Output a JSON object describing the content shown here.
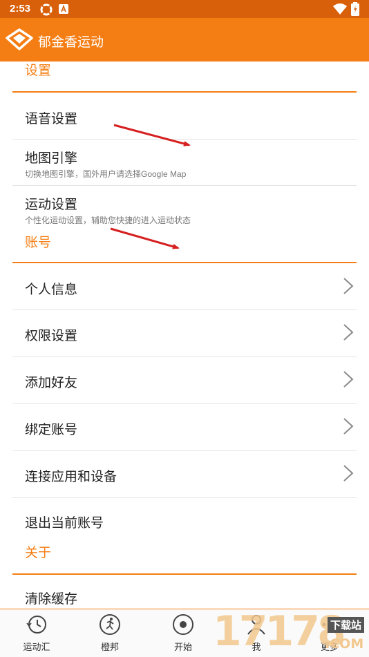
{
  "status_bar": {
    "time": "2:53",
    "icons": [
      "sync-icon",
      "a-badge-icon",
      "wifi-icon",
      "battery-icon"
    ]
  },
  "app_bar": {
    "title": "郁金香运动",
    "logo_icon": "tulip-diamond-logo-icon"
  },
  "sections": {
    "settings_header": "设置",
    "account_header": "账号",
    "about_header": "关于"
  },
  "settings_items": [
    {
      "label": "语音设置",
      "subtitle": ""
    },
    {
      "label": "地图引擎",
      "subtitle": "切换地图引擎，国外用户请选择Google Map"
    },
    {
      "label": "运动设置",
      "subtitle": "个性化运动设置，辅助您快捷的进入运动状态"
    }
  ],
  "account_items": [
    {
      "label": "个人信息",
      "icon": "chevron-right-icon"
    },
    {
      "label": "权限设置",
      "icon": "chevron-right-icon"
    },
    {
      "label": "添加好友",
      "icon": "chevron-right-icon"
    },
    {
      "label": "绑定账号",
      "icon": "chevron-right-icon"
    },
    {
      "label": "连接应用和设备",
      "icon": "chevron-right-icon"
    },
    {
      "label": "退出当前账号"
    }
  ],
  "about_items": [
    {
      "label": "清除缓存"
    }
  ],
  "bottom_nav": [
    {
      "label": "运动汇",
      "icon": "clock-history-icon"
    },
    {
      "label": "橙邦",
      "icon": "runner-icon"
    },
    {
      "label": "开始",
      "icon": "record-start-icon"
    },
    {
      "label": "我",
      "icon": "person-icon"
    },
    {
      "label": "更多",
      "icon": "more-icon"
    }
  ],
  "watermark": {
    "digits": "17178",
    "top_text": "下载站",
    "bottom_text": ".COM"
  },
  "colors": {
    "status_bar": "#d9600a",
    "app_bar": "#f57e14",
    "accent": "#f57e14",
    "annotation_arrow": "#d62020"
  }
}
